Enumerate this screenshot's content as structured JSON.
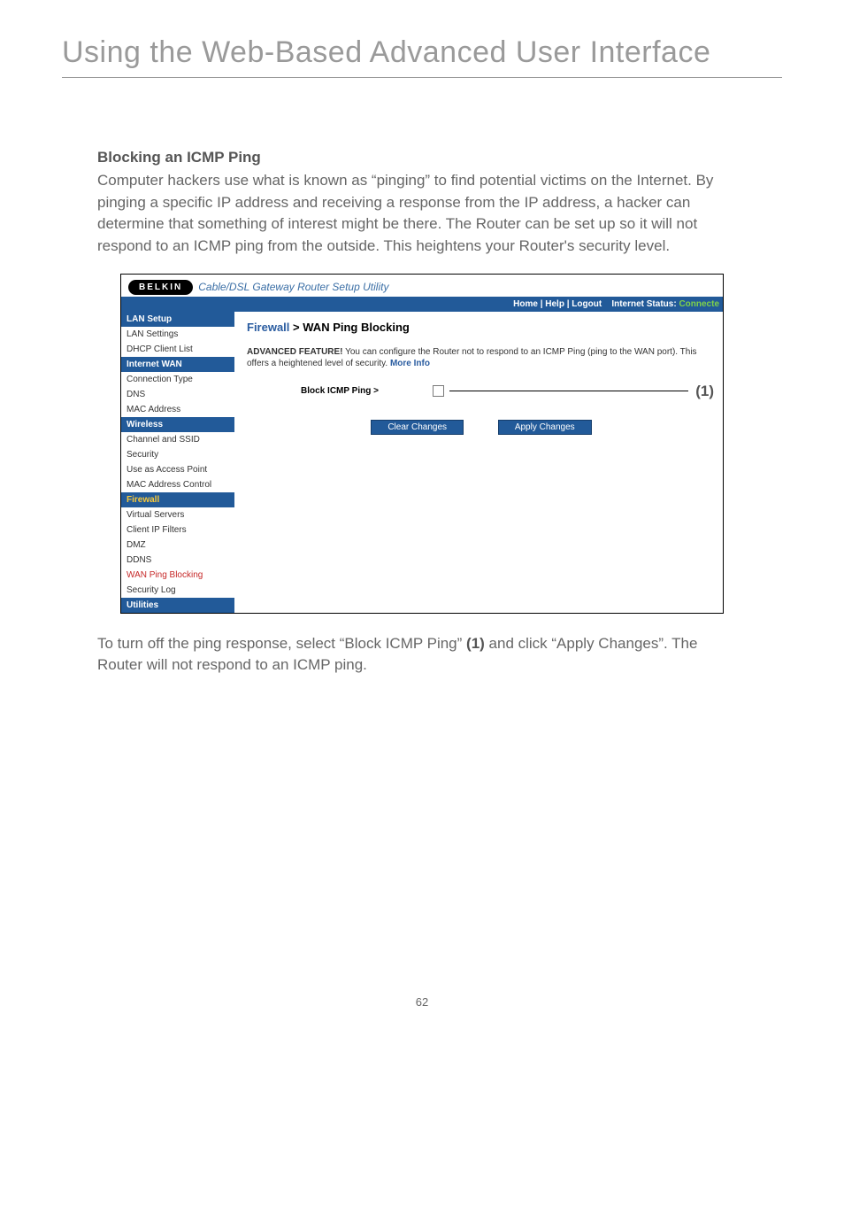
{
  "page": {
    "title": "Using the Web-Based Advanced User Interface",
    "number": "62"
  },
  "section": {
    "heading": "Blocking an ICMP Ping",
    "body": "Computer hackers use what is known as “pinging” to find potential victims on the Internet. By pinging a specific IP address and receiving a response from the IP address, a hacker can determine that something of interest might be there. The Router can be set up so it will not respond to an ICMP ping from the outside. This heightens your Router's security level."
  },
  "figure": {
    "brand": "BELKIN",
    "tagline": "Cable/DSL Gateway Router Setup Utility",
    "topbar": {
      "links": "Home | Help | Logout",
      "status_label": "Internet Status:",
      "status_value": "Connecte"
    },
    "sidebar": {
      "groups": [
        {
          "header": "LAN Setup",
          "items": [
            "LAN Settings",
            "DHCP Client List"
          ]
        },
        {
          "header": "Internet WAN",
          "items": [
            "Connection Type",
            "DNS",
            "MAC Address"
          ]
        },
        {
          "header": "Wireless",
          "items": [
            "Channel and SSID",
            "Security",
            "Use as Access Point",
            "MAC Address Control"
          ]
        },
        {
          "header": "Firewall",
          "header_style": "firewall",
          "items": [
            "Virtual Servers",
            "Client IP Filters",
            "DMZ",
            "DDNS",
            {
              "label": "WAN Ping Blocking",
              "active": true
            },
            "Security Log"
          ]
        },
        {
          "header": "Utilities",
          "items": []
        }
      ]
    },
    "main": {
      "breadcrumb_fw": "Firewall",
      "breadcrumb_sep": " > ",
      "breadcrumb_page": "WAN Ping Blocking",
      "adv_lead": "ADVANCED FEATURE!",
      "adv_text": " You can configure the Router not to respond to an ICMP Ping (ping to the WAN port). This offers a heightened level of security. ",
      "adv_more": "More Info",
      "form_label": "Block ICMP Ping >",
      "callout": "(1)",
      "btn_clear": "Clear Changes",
      "btn_apply": "Apply Changes"
    }
  },
  "footer_para": {
    "pre": "To turn off the ping response, select “Block ICMP Ping” ",
    "bold": "(1)",
    "post": " and click “Apply Changes”. The Router will not respond to an ICMP ping."
  }
}
